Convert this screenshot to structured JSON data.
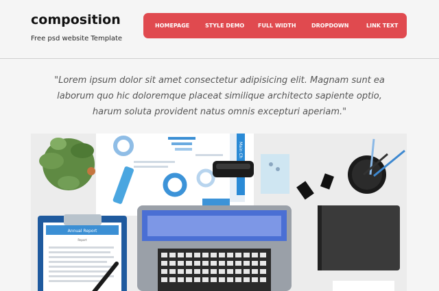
{
  "brand": {
    "title": "composition",
    "tagline": "Free psd website Template"
  },
  "nav": {
    "items": [
      {
        "label": "HOMEPAGE"
      },
      {
        "label": "STYLE DEMO"
      },
      {
        "label": "FULL WIDTH"
      },
      {
        "label": "DROPDOWN"
      },
      {
        "label": "LINK TEXT"
      }
    ]
  },
  "intro": {
    "quote": "\"Lorem ipsum dolor sit amet consectetur adipisicing elit. Magnam sunt ea laborum quo hic doloremque placeat similique architecto sapiente optio, harum soluta provident natus omnis excepturi aperiam.\""
  },
  "hero": {
    "report_title": "Annual Report",
    "report_sub": "Report",
    "booklet_label": "Main Ch"
  },
  "colors": {
    "accent": "#e04a4f",
    "background": "#f5f5f5"
  }
}
